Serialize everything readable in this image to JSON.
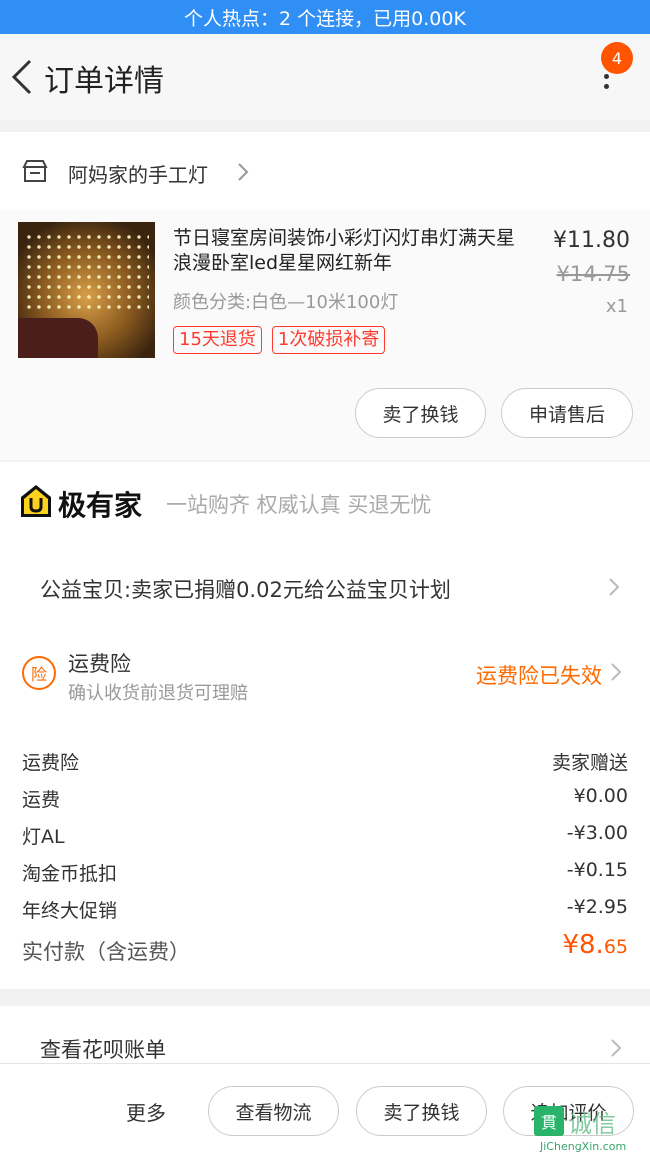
{
  "status_bar": {
    "text": "个人热点：2 个连接，已用0.00K"
  },
  "nav": {
    "title": "订单详情",
    "badge_count": "4",
    "icons": {
      "back": "chevron-left-icon",
      "more": "more-vertical-icon"
    }
  },
  "store": {
    "name": "阿妈家的手工灯",
    "icon": "store-icon"
  },
  "item": {
    "title": "节日寝室房间装饰小彩灯闪灯串灯满天星浪漫卧室led星星网红新年",
    "sku": "颜色分类:白色—10米100灯",
    "tags": [
      "15天退货",
      "1次破损补寄"
    ],
    "price": "¥11.80",
    "original_price": "¥14.75",
    "quantity": "x1",
    "buttons": {
      "sell": "卖了换钱",
      "after_sale": "申请售后"
    }
  },
  "brand": {
    "name": "极有家",
    "slogan": "一站购齐 权威认真 买退无忧",
    "logo": "home-u-logo-icon"
  },
  "charity": {
    "text": "公益宝贝:卖家已捐赠0.02元给公益宝贝计划"
  },
  "insurance": {
    "icon_text": "险",
    "title": "运费险",
    "subtitle": "确认收货前退货可理赔",
    "status": "运费险已失效"
  },
  "fees": [
    {
      "label": "运费险",
      "value": "卖家赠送"
    },
    {
      "label": "运费",
      "value": "¥0.00"
    },
    {
      "label": "灯AL",
      "value": "-¥3.00"
    },
    {
      "label": "淘金币抵扣",
      "value": "-¥0.15"
    },
    {
      "label": "年终大促销",
      "value": "-¥2.95"
    }
  ],
  "total": {
    "label": "实付款（含运费）",
    "amount_main": "¥8.",
    "amount_decimal": "65"
  },
  "huabei": {
    "label": "查看花呗账单"
  },
  "bottom_bar": {
    "more": "更多",
    "buttons": [
      "查看物流",
      "卖了换钱",
      "追加评价"
    ]
  },
  "watermark": {
    "text": "诚信",
    "box_text": "貫",
    "sub": "JiChengXin.com"
  },
  "colors": {
    "status_bar": "#2f8ff5",
    "accent_orange": "#ff5500",
    "tag_red": "#ff3b30"
  }
}
